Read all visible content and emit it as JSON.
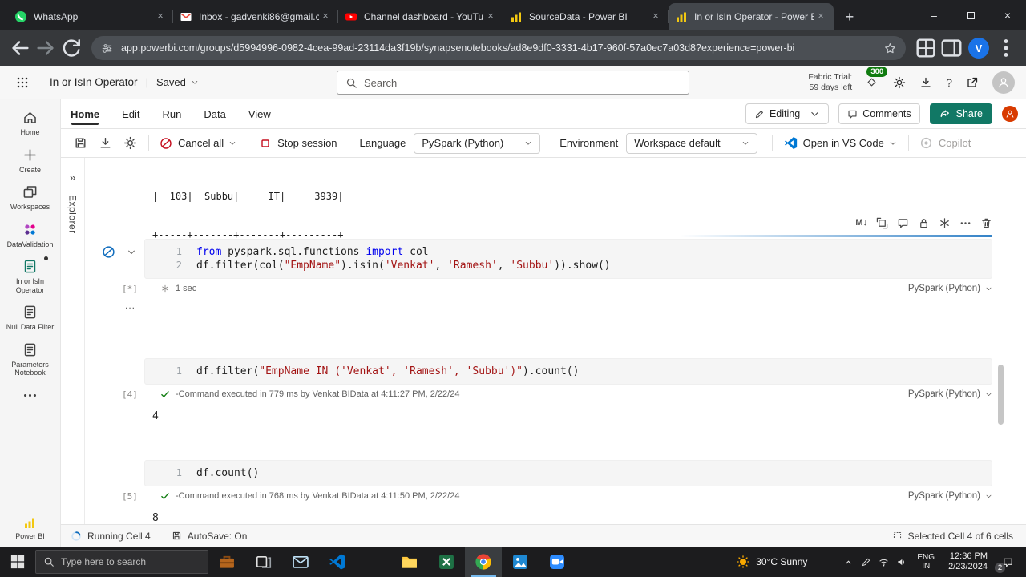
{
  "colors": {
    "share-green": "#117865",
    "badge-green": "#107C10",
    "kw-blue": "#0000EE",
    "str-red": "#A31515",
    "run-blue": "#0F6CBD",
    "pbi-yellow": "#F2C811"
  },
  "browser": {
    "tabs": [
      {
        "icon": "whatsapp",
        "label": "WhatsApp"
      },
      {
        "icon": "gmail",
        "label": "Inbox - gadvenki86@gmail.c"
      },
      {
        "icon": "youtube",
        "label": "Channel dashboard - YouTu"
      },
      {
        "icon": "pbi-favicon",
        "label": "SourceData - Power BI"
      },
      {
        "icon": "pbi-favicon",
        "label": "In or IsIn Operator - Power B",
        "active": true
      }
    ],
    "url": "app.powerbi.com/groups/d5994996-0982-4cea-99ad-23114da3f19b/synapsenotebooks/ad8e9df0-3331-4b17-960f-57a0ec7a03d8?experience=power-bi",
    "profile_initial": "V"
  },
  "header": {
    "title": "In or IsIn Operator",
    "separator": "|",
    "save_state": "Saved",
    "search_placeholder": "Search",
    "trial_label": "Fabric Trial:",
    "trial_days": "59 days left",
    "trial_badge": "300",
    "help_glyph": "?"
  },
  "ribbon": {
    "tabs": [
      "Home",
      "Edit",
      "Run",
      "Data",
      "View"
    ],
    "active_tab": "Home",
    "editing_label": "Editing",
    "comments_label": "Comments",
    "share_label": "Share"
  },
  "toolbar": {
    "cancel_all": "Cancel all",
    "stop_session": "Stop session",
    "language_label": "Language",
    "language_value": "PySpark (Python)",
    "environment_label": "Environment",
    "environment_value": "Workspace default",
    "vscode_label": "Open in VS Code",
    "copilot_label": "Copilot"
  },
  "sidebar": {
    "items": [
      {
        "icon": "home",
        "label": "Home"
      },
      {
        "icon": "plus",
        "label": "Create"
      },
      {
        "icon": "workspaces",
        "label": "Workspaces"
      },
      {
        "icon": "app-grid",
        "label": "DataValidation"
      },
      {
        "icon": "notebook",
        "label": "In or IsIn Operator",
        "active": true,
        "dot": true
      },
      {
        "icon": "notebook",
        "label": "Null Data Filter"
      },
      {
        "icon": "notebook",
        "label": "Parameters Notebook"
      },
      {
        "icon": "dots-h",
        "label": ""
      }
    ],
    "footer_label": "Power BI"
  },
  "explorer": {
    "collapse_glyph": "»",
    "label": "Explorer"
  },
  "notebook": {
    "spill_output": [
      "|  103|  Subbu|     IT|     3939|",
      "+-----+-------+-------+---------+"
    ],
    "cell_toolbar": [
      "markdown",
      "resize",
      "comment",
      "lock",
      "freeze",
      "more-h",
      "trash"
    ],
    "markdown_glyph": "M↓",
    "ellipsis": "...",
    "cells": [
      {
        "gutter": "[*]",
        "lines": [
          {
            "n": "1",
            "t": [
              [
                "k",
                "from"
              ],
              [
                "p",
                " pyspark.sql.functions "
              ],
              [
                "k",
                "import"
              ],
              [
                "p",
                " col"
              ]
            ]
          },
          {
            "n": "2",
            "t": [
              [
                "p",
                "df.filter(col("
              ],
              [
                "s",
                "\"EmpName\""
              ],
              [
                "p",
                ").isin("
              ],
              [
                "s",
                "'Venkat'"
              ],
              [
                "p",
                ", "
              ],
              [
                "s",
                "'Ramesh'"
              ],
              [
                "p",
                ", "
              ],
              [
                "s",
                "'Subbu'"
              ],
              [
                "p",
                ")).show()"
              ]
            ]
          }
        ],
        "status_icon": "run-asterisk",
        "status_text": "1 sec",
        "lang": "PySpark (Python)",
        "running": true,
        "controls": true
      },
      {
        "gutter": "[4]",
        "lines": [
          {
            "n": "1",
            "t": [
              [
                "p",
                "df.filter("
              ],
              [
                "s",
                "\"EmpName IN ('Venkat', 'Ramesh', 'Subbu')\""
              ],
              [
                "p",
                ").count()"
              ]
            ]
          }
        ],
        "status_icon": "check",
        "status_text": "-Command executed in 779 ms by Venkat BIData at 4:11:27 PM, 2/22/24",
        "lang": "PySpark (Python)",
        "output": "4"
      },
      {
        "gutter": "[5]",
        "lines": [
          {
            "n": "1",
            "t": [
              [
                "p",
                "df.count()"
              ]
            ]
          }
        ],
        "status_icon": "check",
        "status_text": "-Command executed in 768 ms by Venkat BIData at 4:11:50 PM, 2/22/24",
        "lang": "PySpark (Python)",
        "output": "8"
      }
    ]
  },
  "status_bar": {
    "running": "Running Cell 4",
    "autosave": "AutoSave: On",
    "selected": "Selected Cell 4 of 6 cells"
  },
  "taskbar": {
    "search_placeholder": "Type here to search",
    "apps": [
      {
        "icon": "briefcase",
        "name": "briefcase"
      },
      {
        "icon": "task-view",
        "name": "task-view"
      },
      {
        "icon": "mail",
        "name": "mail"
      },
      {
        "icon": "vscode",
        "name": "vscode"
      },
      {
        "icon": "folder",
        "name": "file-explorer"
      },
      {
        "icon": "excel",
        "name": "excel"
      },
      {
        "icon": "chrome",
        "name": "chrome",
        "active": true
      },
      {
        "icon": "photos",
        "name": "photos"
      },
      {
        "icon": "zoom",
        "name": "zoom"
      }
    ],
    "weather": "30°C Sunny",
    "lang_top": "ENG",
    "lang_bottom": "IN",
    "time": "12:36 PM",
    "date": "2/23/2024",
    "badge": "2"
  }
}
